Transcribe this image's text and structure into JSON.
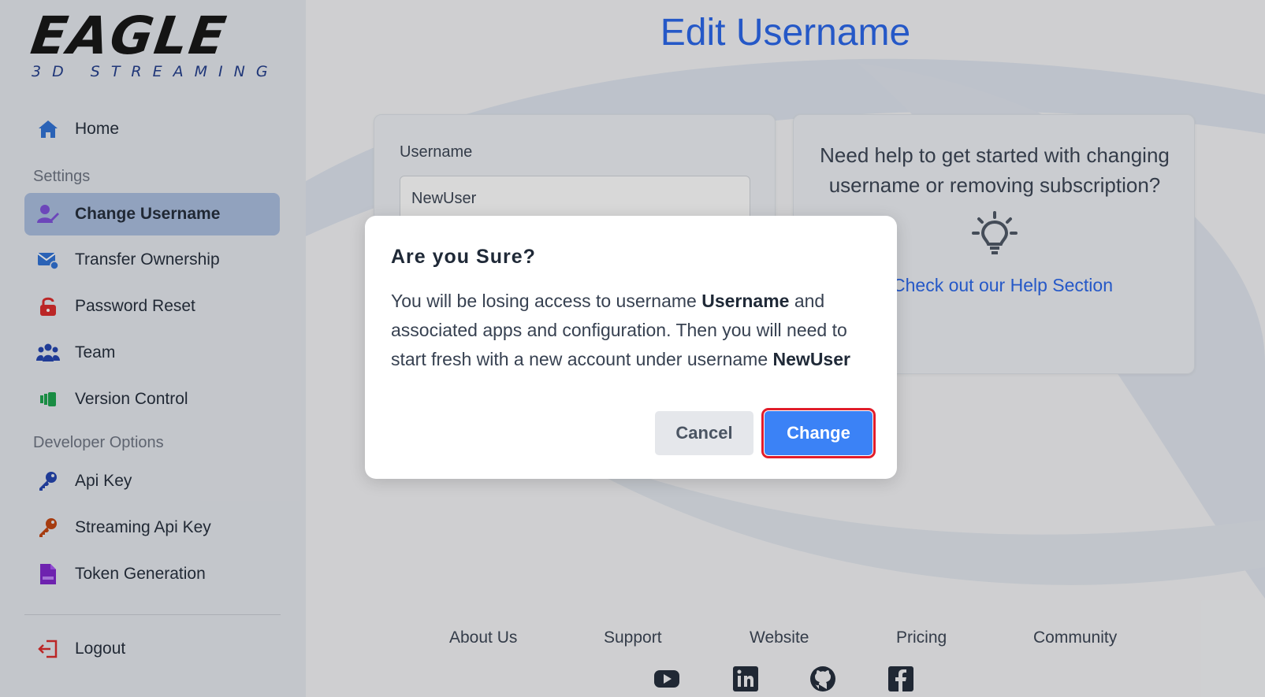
{
  "logo": {
    "main": "EAGLE",
    "sub": "3D STREAMING"
  },
  "sidebar": {
    "items": [
      {
        "label": "Home",
        "icon": "home-icon"
      },
      {
        "label": "Change Username",
        "icon": "user-edit-icon"
      },
      {
        "label": "Transfer Ownership",
        "icon": "mail-transfer-icon"
      },
      {
        "label": "Password Reset",
        "icon": "unlock-icon"
      },
      {
        "label": "Team",
        "icon": "team-icon"
      },
      {
        "label": "Version Control",
        "icon": "version-icon"
      },
      {
        "label": "Api Key",
        "icon": "key-icon"
      },
      {
        "label": "Streaming Api Key",
        "icon": "key-icon"
      },
      {
        "label": "Token Generation",
        "icon": "json-file-icon"
      },
      {
        "label": "Logout",
        "icon": "logout-icon"
      }
    ],
    "sections": {
      "settings": "Settings",
      "developer": "Developer Options"
    }
  },
  "main": {
    "title": "Edit Username",
    "form": {
      "label": "Username",
      "value": "NewUser"
    },
    "help": {
      "text": "Need help to get started with changing username or removing subscription?",
      "link": "Check out our Help Section"
    }
  },
  "footer": {
    "links": [
      "About Us",
      "Support",
      "Website",
      "Pricing",
      "Community"
    ],
    "social": [
      "youtube-icon",
      "linkedin-icon",
      "github-icon",
      "facebook-icon"
    ]
  },
  "modal": {
    "title": "Are you Sure?",
    "body_1": "You will be losing access to username ",
    "old_username": "Username",
    "body_2": " and associated apps and configuration. Then you will need to start fresh with a new account under username ",
    "new_username": "NewUser",
    "cancel_label": "Cancel",
    "change_label": "Change"
  },
  "colors": {
    "accent": "#2563eb",
    "active_bg": "#a9bde0",
    "highlight": "#e11d2a"
  }
}
